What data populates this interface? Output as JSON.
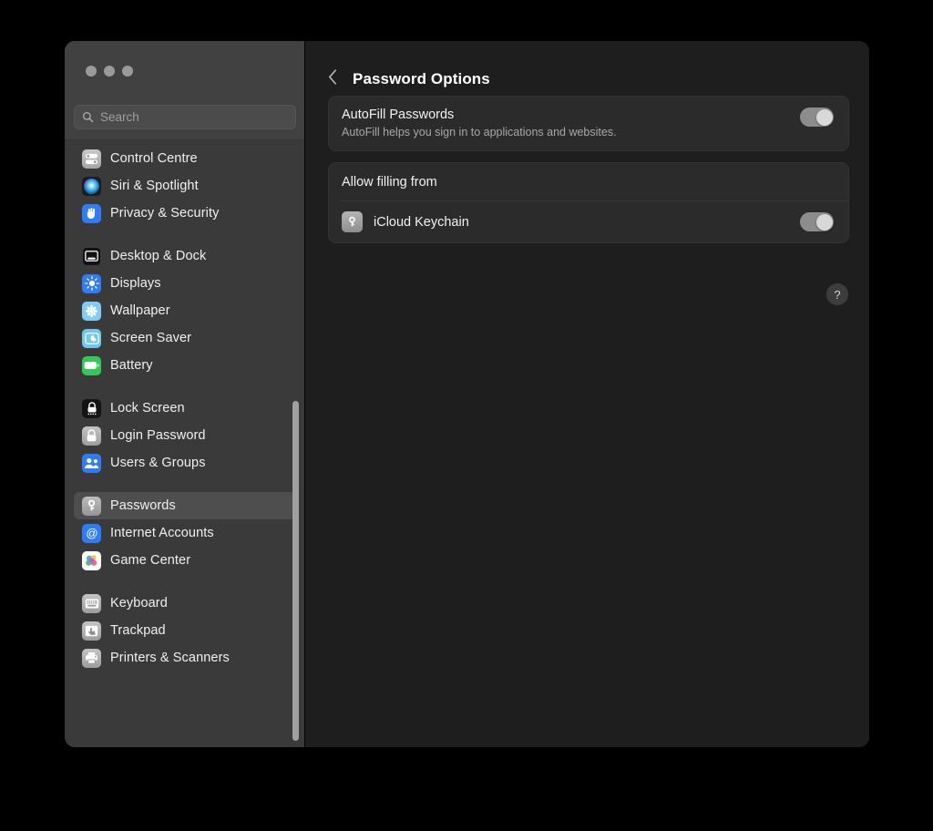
{
  "window": {
    "traffic_lights": [
      "close",
      "minimize",
      "zoom"
    ]
  },
  "search": {
    "placeholder": "Search",
    "value": "",
    "icon": "search-icon"
  },
  "sidebar": {
    "groups": [
      {
        "items": [
          {
            "label": "Control Centre",
            "icon": "control-centre-icon",
            "selected": false
          },
          {
            "label": "Siri & Spotlight",
            "icon": "siri-icon",
            "selected": false
          },
          {
            "label": "Privacy & Security",
            "icon": "privacy-security-icon",
            "selected": false
          }
        ]
      },
      {
        "items": [
          {
            "label": "Desktop & Dock",
            "icon": "desktop-dock-icon",
            "selected": false
          },
          {
            "label": "Displays",
            "icon": "displays-icon",
            "selected": false
          },
          {
            "label": "Wallpaper",
            "icon": "wallpaper-icon",
            "selected": false
          },
          {
            "label": "Screen Saver",
            "icon": "screen-saver-icon",
            "selected": false
          },
          {
            "label": "Battery",
            "icon": "battery-icon",
            "selected": false
          }
        ]
      },
      {
        "items": [
          {
            "label": "Lock Screen",
            "icon": "lock-screen-icon",
            "selected": false
          },
          {
            "label": "Login Password",
            "icon": "login-password-icon",
            "selected": false
          },
          {
            "label": "Users & Groups",
            "icon": "users-groups-icon",
            "selected": false
          }
        ]
      },
      {
        "items": [
          {
            "label": "Passwords",
            "icon": "passwords-icon",
            "selected": true
          },
          {
            "label": "Internet Accounts",
            "icon": "internet-accounts-icon",
            "selected": false
          },
          {
            "label": "Game Center",
            "icon": "game-center-icon",
            "selected": false
          }
        ]
      },
      {
        "items": [
          {
            "label": "Keyboard",
            "icon": "keyboard-icon",
            "selected": false
          },
          {
            "label": "Trackpad",
            "icon": "trackpad-icon",
            "selected": false
          },
          {
            "label": "Printers & Scanners",
            "icon": "printers-scanners-icon",
            "selected": false
          }
        ]
      }
    ]
  },
  "main": {
    "back_icon": "chevron-left-icon",
    "title": "Password Options",
    "autofill": {
      "title": "AutoFill Passwords",
      "subtitle": "AutoFill helps you sign in to applications and websites.",
      "toggle_state": "on"
    },
    "allow_filling": {
      "section_title": "Allow filling from",
      "sources": [
        {
          "label": "iCloud Keychain",
          "icon": "key-icon",
          "toggle_state": "on"
        }
      ]
    },
    "help": {
      "label": "?",
      "icon": "help-icon"
    }
  },
  "colors": {
    "page_background": "#000000",
    "sidebar": "#3a3a3a",
    "sidebar_top": "#414141",
    "content": "#1e1e1e",
    "card": "#2b2b2b",
    "selected_row": "#4e4e4e",
    "toggle_on_inactive": "#8d8d8d",
    "text_primary": "#f2f2f2",
    "text_secondary": "#a8a8a8"
  }
}
